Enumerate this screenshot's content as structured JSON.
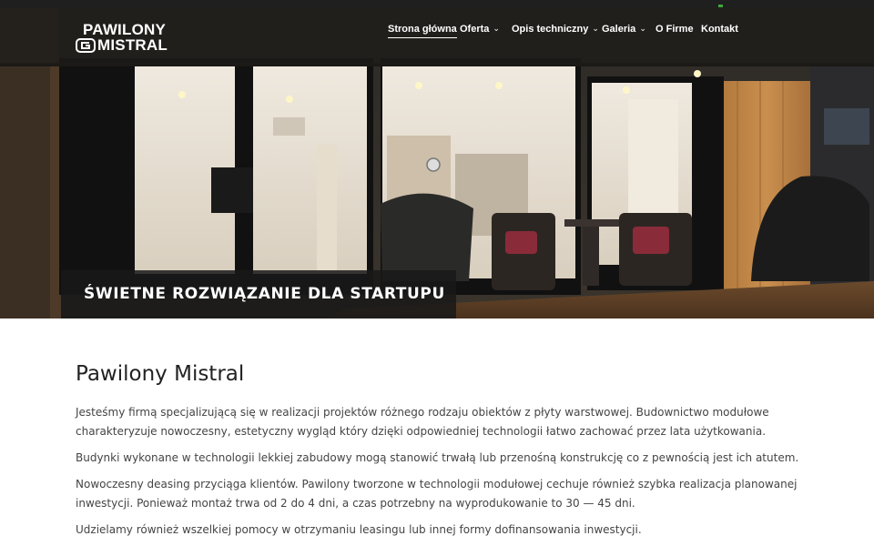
{
  "brand": {
    "line1": "PAWILONY",
    "line2": "MISTRAL"
  },
  "nav": {
    "items": [
      {
        "label": "Strona główna",
        "active": true,
        "has_dropdown": false
      },
      {
        "label": "Oferta",
        "active": false,
        "has_dropdown": true
      },
      {
        "label": "Opis techniczny",
        "active": false,
        "has_dropdown": true
      },
      {
        "label": "Galeria",
        "active": false,
        "has_dropdown": true
      },
      {
        "label": "O Firme",
        "active": false,
        "has_dropdown": false
      },
      {
        "label": "Kontakt",
        "active": false,
        "has_dropdown": false
      }
    ],
    "dropdown_icon": "chevron-down-icon"
  },
  "hero": {
    "caption": "ŚWIETNE ROZWIĄZANIE DLA STARTUPU"
  },
  "main": {
    "title": "Pawilony Mistral",
    "paragraphs": [
      "Jesteśmy firmą specjalizującą się w realizacji projektów różnego rodzaju obiektów z płyty warstwowej. Budownictwo modułowe charakteryzuje nowoczesny, estetyczny wygląd który dzięki odpowiedniej technologii łatwo zachować przez lata użytkowania.",
      "Budynki wykonane w technologii lekkiej zabudowy mogą stanowić trwałą lub przenośną konstrukcję co z pewnością jest ich atutem.",
      "Nowoczesny deasing przyciąga klientów. Pawilony tworzone w technologii modułowej cechuje również szybka realizacja planowanej inwestycji. Ponieważ montaż trwa od 2 do 4 dni, a czas potrzebny na wyprodukowanie to 30 — 45 dni.",
      "Udzielamy również wszelkiej pomocy w otrzymaniu leasingu lub innej formy dofinansowania inwestycji."
    ]
  },
  "colors": {
    "navbar_bg": "#1e1c1a",
    "text": "#444444",
    "heading": "#222222"
  }
}
